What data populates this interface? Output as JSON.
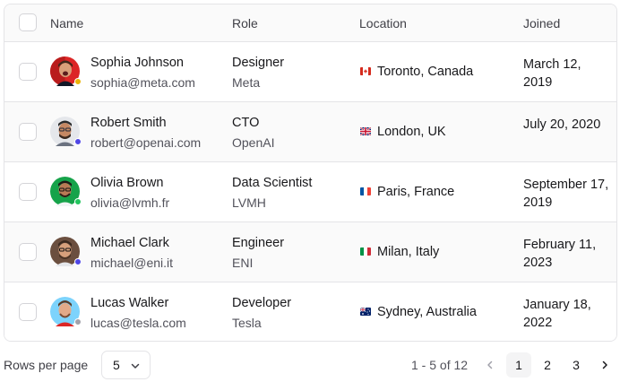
{
  "table": {
    "headers": {
      "name": "Name",
      "role": "Role",
      "location": "Location",
      "joined": "Joined"
    },
    "rows": [
      {
        "name": "Sophia Johnson",
        "email": "sophia@meta.com",
        "role": "Designer",
        "company": "Meta",
        "location": "Toronto, Canada",
        "flag": "flag-canada-icon",
        "joined": "March 12, 2019",
        "status_color": "#eab308"
      },
      {
        "name": "Robert Smith",
        "email": "robert@openai.com",
        "role": "CTO",
        "company": "OpenAI",
        "location": "London, UK",
        "flag": "flag-uk-icon",
        "joined": "July 20, 2020",
        "status_color": "#4f46e5"
      },
      {
        "name": "Olivia Brown",
        "email": "olivia@lvmh.fr",
        "role": "Data Scientist",
        "company": "LVMH",
        "location": "Paris, France",
        "flag": "flag-france-icon",
        "joined": "September 17, 2019",
        "status_color": "#22c55e"
      },
      {
        "name": "Michael Clark",
        "email": "michael@eni.it",
        "role": "Engineer",
        "company": "ENI",
        "location": "Milan, Italy",
        "flag": "flag-italy-icon",
        "joined": "February 11, 2023",
        "status_color": "#4f46e5"
      },
      {
        "name": "Lucas Walker",
        "email": "lucas@tesla.com",
        "role": "Developer",
        "company": "Tesla",
        "location": "Sydney, Australia",
        "flag": "flag-australia-icon",
        "joined": "January 18, 2022",
        "status_color": "#a1a1aa"
      }
    ]
  },
  "footer": {
    "rows_per_page_label": "Rows per page",
    "rows_per_page_value": "5",
    "range_text": "1 - 5 of 12",
    "pages": [
      "1",
      "2",
      "3"
    ],
    "active_page": "1"
  },
  "icons": {
    "select_chevron": "chevron-down-icon",
    "prev": "chevron-left-icon",
    "next": "chevron-right-icon"
  }
}
